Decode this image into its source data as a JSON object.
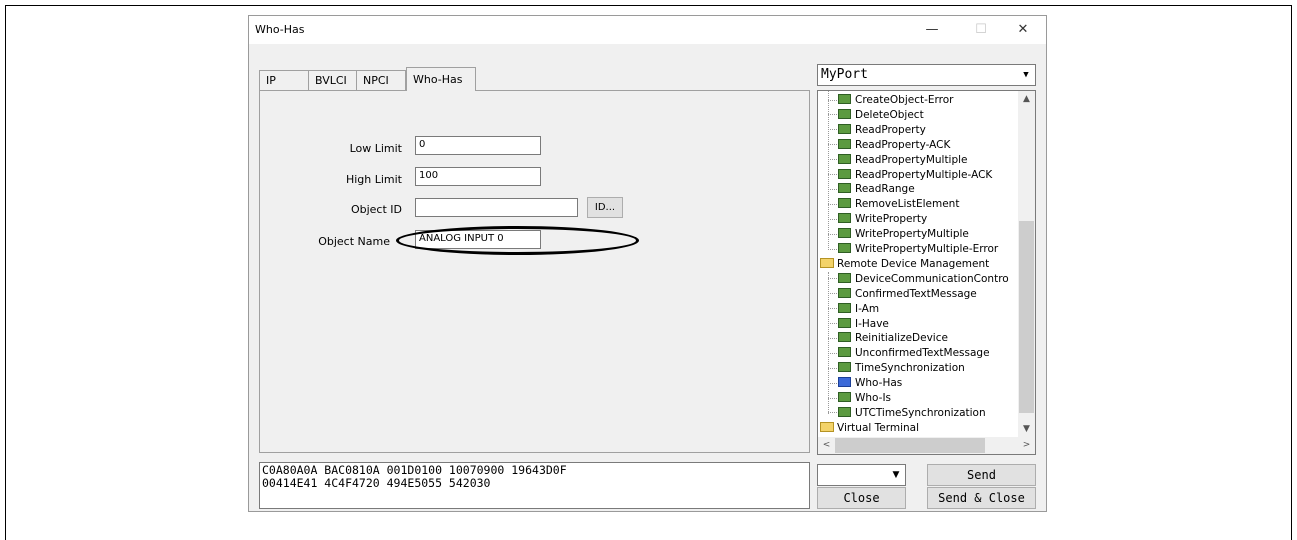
{
  "window": {
    "title": "Who-Has",
    "minimize": "—",
    "maximize": "☐",
    "close": "✕"
  },
  "tabs": [
    {
      "label": "IP"
    },
    {
      "label": "BVLCI"
    },
    {
      "label": "NPCI"
    },
    {
      "label": "Who-Has"
    }
  ],
  "form": {
    "low_limit_label": "Low Limit",
    "low_limit_value": "0",
    "high_limit_label": "High Limit",
    "high_limit_value": "100",
    "object_id_label": "Object ID",
    "object_id_value": "",
    "id_button": "ID...",
    "object_name_label": "Object Name",
    "object_name_value": "ANALOG INPUT 0"
  },
  "hex": {
    "line1": "C0A80A0A BAC0810A 001D0100 10070900 19643D0F",
    "line2": "00414E41 4C4F4720 494E5055 542030"
  },
  "port": {
    "selected": "MyPort"
  },
  "tree": {
    "items": [
      {
        "label": "CreateObject-Error",
        "type": "leaf"
      },
      {
        "label": "DeleteObject",
        "type": "leaf"
      },
      {
        "label": "ReadProperty",
        "type": "leaf"
      },
      {
        "label": "ReadProperty-ACK",
        "type": "leaf"
      },
      {
        "label": "ReadPropertyMultiple",
        "type": "leaf"
      },
      {
        "label": "ReadPropertyMultiple-ACK",
        "type": "leaf"
      },
      {
        "label": "ReadRange",
        "type": "leaf"
      },
      {
        "label": "RemoveListElement",
        "type": "leaf"
      },
      {
        "label": "WriteProperty",
        "type": "leaf"
      },
      {
        "label": "WritePropertyMultiple",
        "type": "leaf"
      },
      {
        "label": "WritePropertyMultiple-Error",
        "type": "leaf"
      },
      {
        "label": "Remote Device Management",
        "type": "folder-open"
      },
      {
        "label": "DeviceCommunicationContro",
        "type": "leaf"
      },
      {
        "label": "ConfirmedTextMessage",
        "type": "leaf"
      },
      {
        "label": "I-Am",
        "type": "leaf"
      },
      {
        "label": "I-Have",
        "type": "leaf"
      },
      {
        "label": "ReinitializeDevice",
        "type": "leaf"
      },
      {
        "label": "UnconfirmedTextMessage",
        "type": "leaf"
      },
      {
        "label": "TimeSynchronization",
        "type": "leaf"
      },
      {
        "label": "Who-Has",
        "type": "leaf-selected"
      },
      {
        "label": "Who-Is",
        "type": "leaf"
      },
      {
        "label": "UTCTimeSynchronization",
        "type": "leaf"
      },
      {
        "label": "Virtual Terminal",
        "type": "folder"
      }
    ]
  },
  "buttons": {
    "send": "Send",
    "close": "Close",
    "send_close": "Send & Close"
  },
  "colors": {
    "leaf_icon": "#5c9a40",
    "selected_icon": "#3c6ad8",
    "folder": "#f3d36a"
  }
}
